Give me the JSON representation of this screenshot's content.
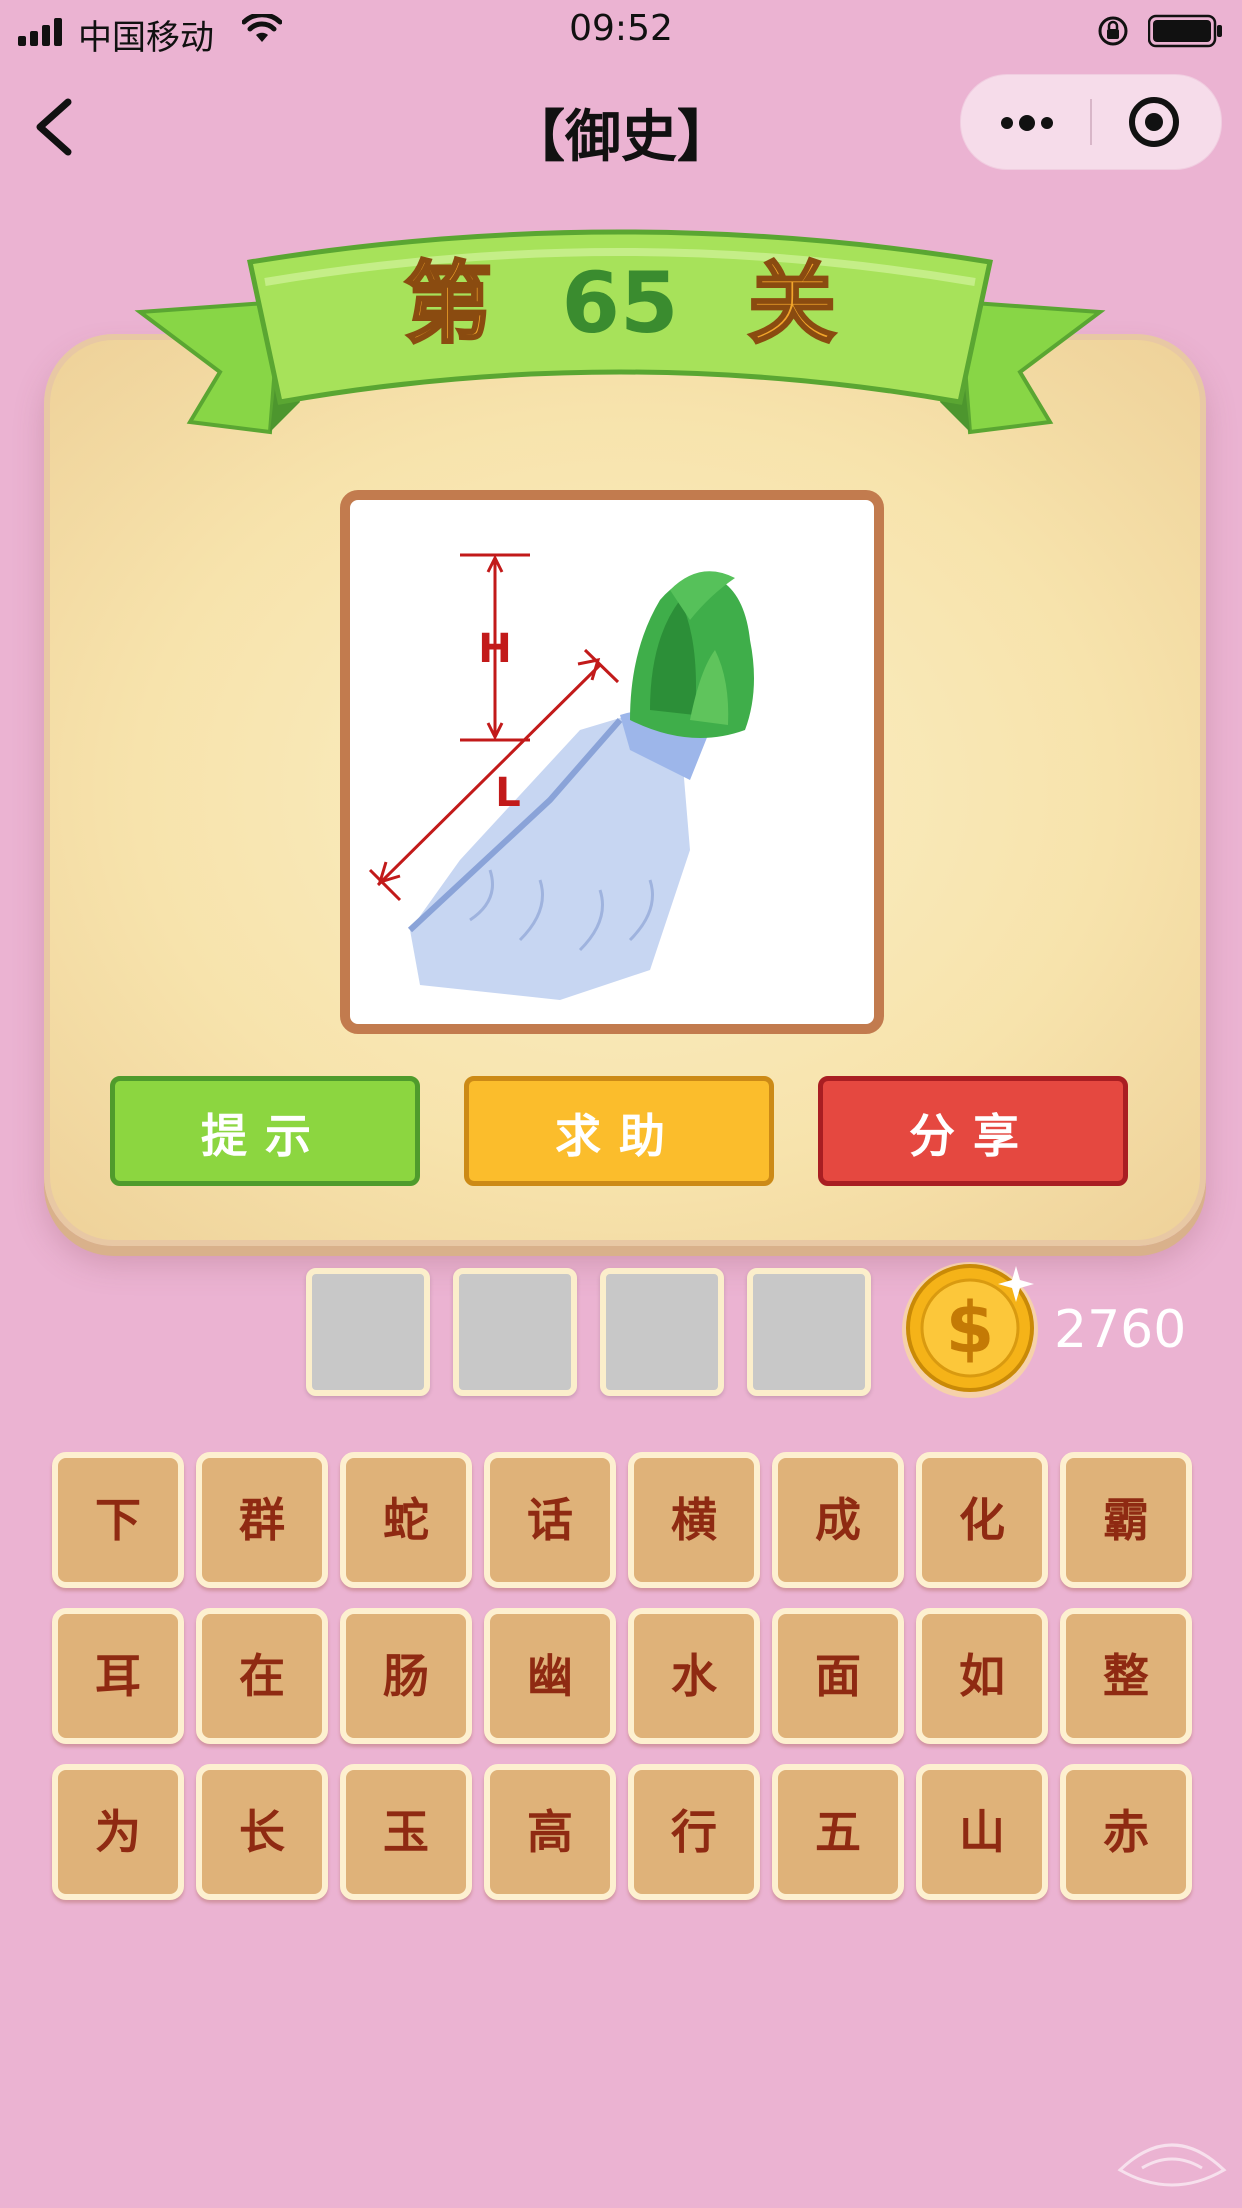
{
  "status_bar": {
    "carrier": "中国移动",
    "time": "09:52"
  },
  "nav": {
    "title": "【御史】"
  },
  "level": {
    "label_prefix": "第",
    "number": "65",
    "label_suffix": "关"
  },
  "actions": {
    "hint": "提示",
    "help": "求助",
    "share": "分享"
  },
  "answer": {
    "slots": [
      "",
      "",
      "",
      ""
    ]
  },
  "coins": {
    "count": "2760"
  },
  "picture": {
    "labels": {
      "h": "H",
      "l": "L"
    }
  },
  "characters": [
    [
      "下",
      "群",
      "蛇",
      "话",
      "横",
      "成",
      "化",
      "霸"
    ],
    [
      "耳",
      "在",
      "肠",
      "幽",
      "水",
      "面",
      "如",
      "整"
    ],
    [
      "为",
      "长",
      "玉",
      "高",
      "行",
      "五",
      "山",
      "赤"
    ]
  ],
  "colors": {
    "background": "#ebb3d2",
    "hint_button": "#8cd640",
    "help_button": "#fbbd2c",
    "share_button": "#e54840",
    "chip_fill": "#dfb279",
    "chip_text": "#8f2a12"
  }
}
